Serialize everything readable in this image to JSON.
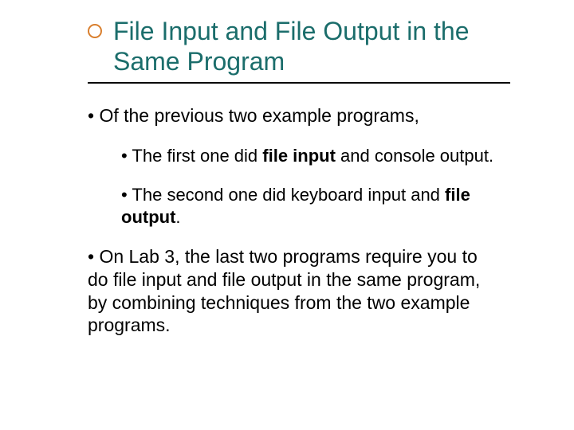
{
  "title": "File Input and File Output in the Same Program",
  "body": {
    "p1_prefix": "• Of the previous two example programs,",
    "p2_a": "• The first one did ",
    "p2_b": "file input",
    "p2_c": " and console output.",
    "p3_a": "• The second one did keyboard input and ",
    "p3_b": "file output",
    "p3_c": ".",
    "p4": "• On Lab 3, the last two programs require you to do file input and file output in the same program, by combining techniques from the two example programs."
  }
}
